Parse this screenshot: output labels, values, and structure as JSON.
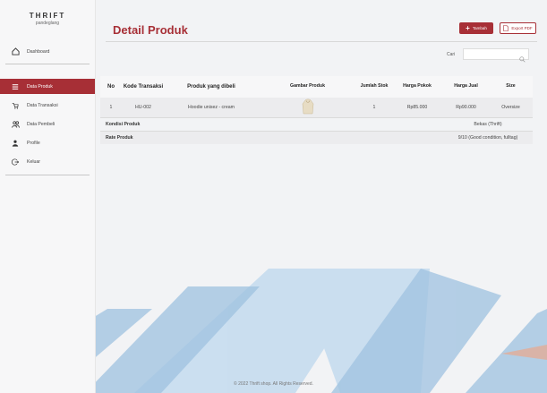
{
  "brand": {
    "title": "THRIFT",
    "subtitle": "pandeglang"
  },
  "sidebar": {
    "items": [
      {
        "label": "Dashboard",
        "icon": "home-icon"
      },
      {
        "label": "Data Produk",
        "icon": "list-icon",
        "active": true
      },
      {
        "label": "Data Transaksi",
        "icon": "cart-icon"
      },
      {
        "label": "Data Pembeli",
        "icon": "users-icon"
      },
      {
        "label": "Profile",
        "icon": "person-icon"
      },
      {
        "label": "Keluar",
        "icon": "logout-icon"
      }
    ]
  },
  "header": {
    "title": "Detail Produk",
    "add_label": "Tambah",
    "export_label": "Export PDF"
  },
  "search": {
    "label": "Cari",
    "value": "",
    "placeholder": ""
  },
  "table": {
    "headers": {
      "no": "No",
      "kode": "Kode Transaksi",
      "produk": "Produk yang dibeli",
      "gambar": "Gambar Produk",
      "stok": "Jumlah Stok",
      "pokok": "Harga Pokok",
      "jual": "Harga Jual",
      "size": "Size"
    },
    "row": {
      "no": "1",
      "kode": "HU-002",
      "produk": "Hoodie unisez - cream",
      "stok": "1",
      "pokok": "Rp85.000",
      "jual": "Rp90.000",
      "size": "Oversize"
    },
    "kondisi": {
      "label": "Kondisi Produk",
      "value": "Bekas (Thrift)"
    },
    "rate": {
      "label": "Rate Produk",
      "value": "9/10 (Good condition, fulltag)"
    }
  },
  "footer": {
    "text": "© 2022 Thrift shop. All Rights Reserved."
  },
  "colors": {
    "accent": "#a72f36",
    "background": "#f2f3f5",
    "watermark": "#9fc2e0"
  }
}
